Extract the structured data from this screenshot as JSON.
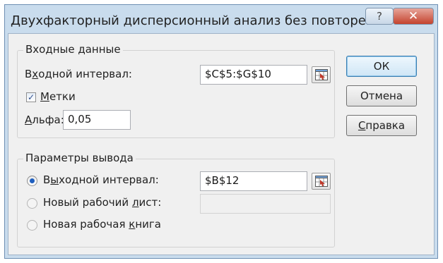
{
  "window": {
    "title": "Двухфакторный дисперсионный анализ без повторений",
    "help_glyph": "?",
    "close_glyph": "✕"
  },
  "input_group": {
    "title": "Входные данные",
    "range_label_pre": "В",
    "range_label_u": "х",
    "range_label_post": "одной интервал:",
    "range_value": "$C$5:$G$10",
    "labels_checked": true,
    "labels_check_mark": "✓",
    "labels_u": "М",
    "labels_post": "етки",
    "alpha_u": "А",
    "alpha_post": "льфа:",
    "alpha_value": "0,05"
  },
  "output_group": {
    "title": "Параметры вывода",
    "output_range_pre": "В",
    "output_range_u": "ы",
    "output_range_post": "ходной интервал:",
    "output_range_value": "$B$12",
    "output_range_selected": true,
    "new_sheet_pre": "Новый рабочий ",
    "new_sheet_u": "л",
    "new_sheet_post": "ист:",
    "new_sheet_value": "",
    "new_book_pre": "Новая рабочая ",
    "new_book_u": "к",
    "new_book_post": "нига"
  },
  "buttons": {
    "ok": "ОК",
    "cancel": "Отмена",
    "help_u": "С",
    "help_post": "правка"
  }
}
